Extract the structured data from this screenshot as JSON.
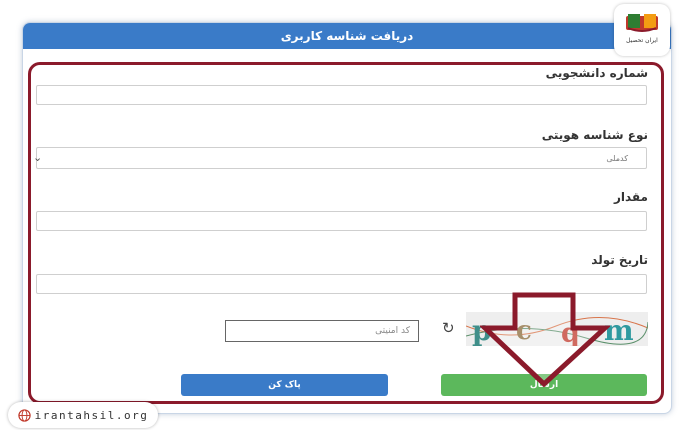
{
  "form": {
    "title": "دریافت شناسه کاربری",
    "student_number_label": "شماره دانشجویی",
    "id_type_label": "نوع شناسه هویتی",
    "id_type_selected": "کدملی",
    "value_label": "مقدار",
    "birth_date_label": "تاریخ تولد",
    "captcha_placeholder": "کد امنیتی",
    "captcha_text": "pcqm",
    "clear_button": "پاک کن",
    "submit_button": "ارسال"
  },
  "branding": {
    "logo_text": "ایران تحصیل",
    "watermark": "irantahsil.org"
  },
  "colors": {
    "header": "#3a7bc8",
    "clear_button": "#3a7bc8",
    "submit_button": "#5cb85c",
    "highlight": "#8b1a2b"
  }
}
